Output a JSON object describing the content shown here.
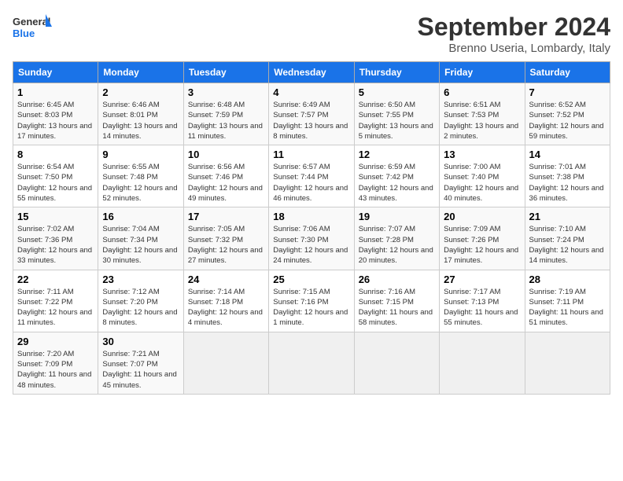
{
  "logo": {
    "line1": "General",
    "line2": "Blue"
  },
  "header": {
    "month": "September 2024",
    "location": "Brenno Useria, Lombardy, Italy"
  },
  "weekdays": [
    "Sunday",
    "Monday",
    "Tuesday",
    "Wednesday",
    "Thursday",
    "Friday",
    "Saturday"
  ],
  "weeks": [
    [
      {
        "day": "1",
        "sunrise": "6:45 AM",
        "sunset": "8:03 PM",
        "daylight": "13 hours and 17 minutes."
      },
      {
        "day": "2",
        "sunrise": "6:46 AM",
        "sunset": "8:01 PM",
        "daylight": "13 hours and 14 minutes."
      },
      {
        "day": "3",
        "sunrise": "6:48 AM",
        "sunset": "7:59 PM",
        "daylight": "13 hours and 11 minutes."
      },
      {
        "day": "4",
        "sunrise": "6:49 AM",
        "sunset": "7:57 PM",
        "daylight": "13 hours and 8 minutes."
      },
      {
        "day": "5",
        "sunrise": "6:50 AM",
        "sunset": "7:55 PM",
        "daylight": "13 hours and 5 minutes."
      },
      {
        "day": "6",
        "sunrise": "6:51 AM",
        "sunset": "7:53 PM",
        "daylight": "13 hours and 2 minutes."
      },
      {
        "day": "7",
        "sunrise": "6:52 AM",
        "sunset": "7:52 PM",
        "daylight": "12 hours and 59 minutes."
      }
    ],
    [
      {
        "day": "8",
        "sunrise": "6:54 AM",
        "sunset": "7:50 PM",
        "daylight": "12 hours and 55 minutes."
      },
      {
        "day": "9",
        "sunrise": "6:55 AM",
        "sunset": "7:48 PM",
        "daylight": "12 hours and 52 minutes."
      },
      {
        "day": "10",
        "sunrise": "6:56 AM",
        "sunset": "7:46 PM",
        "daylight": "12 hours and 49 minutes."
      },
      {
        "day": "11",
        "sunrise": "6:57 AM",
        "sunset": "7:44 PM",
        "daylight": "12 hours and 46 minutes."
      },
      {
        "day": "12",
        "sunrise": "6:59 AM",
        "sunset": "7:42 PM",
        "daylight": "12 hours and 43 minutes."
      },
      {
        "day": "13",
        "sunrise": "7:00 AM",
        "sunset": "7:40 PM",
        "daylight": "12 hours and 40 minutes."
      },
      {
        "day": "14",
        "sunrise": "7:01 AM",
        "sunset": "7:38 PM",
        "daylight": "12 hours and 36 minutes."
      }
    ],
    [
      {
        "day": "15",
        "sunrise": "7:02 AM",
        "sunset": "7:36 PM",
        "daylight": "12 hours and 33 minutes."
      },
      {
        "day": "16",
        "sunrise": "7:04 AM",
        "sunset": "7:34 PM",
        "daylight": "12 hours and 30 minutes."
      },
      {
        "day": "17",
        "sunrise": "7:05 AM",
        "sunset": "7:32 PM",
        "daylight": "12 hours and 27 minutes."
      },
      {
        "day": "18",
        "sunrise": "7:06 AM",
        "sunset": "7:30 PM",
        "daylight": "12 hours and 24 minutes."
      },
      {
        "day": "19",
        "sunrise": "7:07 AM",
        "sunset": "7:28 PM",
        "daylight": "12 hours and 20 minutes."
      },
      {
        "day": "20",
        "sunrise": "7:09 AM",
        "sunset": "7:26 PM",
        "daylight": "12 hours and 17 minutes."
      },
      {
        "day": "21",
        "sunrise": "7:10 AM",
        "sunset": "7:24 PM",
        "daylight": "12 hours and 14 minutes."
      }
    ],
    [
      {
        "day": "22",
        "sunrise": "7:11 AM",
        "sunset": "7:22 PM",
        "daylight": "12 hours and 11 minutes."
      },
      {
        "day": "23",
        "sunrise": "7:12 AM",
        "sunset": "7:20 PM",
        "daylight": "12 hours and 8 minutes."
      },
      {
        "day": "24",
        "sunrise": "7:14 AM",
        "sunset": "7:18 PM",
        "daylight": "12 hours and 4 minutes."
      },
      {
        "day": "25",
        "sunrise": "7:15 AM",
        "sunset": "7:16 PM",
        "daylight": "12 hours and 1 minute."
      },
      {
        "day": "26",
        "sunrise": "7:16 AM",
        "sunset": "7:15 PM",
        "daylight": "11 hours and 58 minutes."
      },
      {
        "day": "27",
        "sunrise": "7:17 AM",
        "sunset": "7:13 PM",
        "daylight": "11 hours and 55 minutes."
      },
      {
        "day": "28",
        "sunrise": "7:19 AM",
        "sunset": "7:11 PM",
        "daylight": "11 hours and 51 minutes."
      }
    ],
    [
      {
        "day": "29",
        "sunrise": "7:20 AM",
        "sunset": "7:09 PM",
        "daylight": "11 hours and 48 minutes."
      },
      {
        "day": "30",
        "sunrise": "7:21 AM",
        "sunset": "7:07 PM",
        "daylight": "11 hours and 45 minutes."
      },
      null,
      null,
      null,
      null,
      null
    ]
  ]
}
